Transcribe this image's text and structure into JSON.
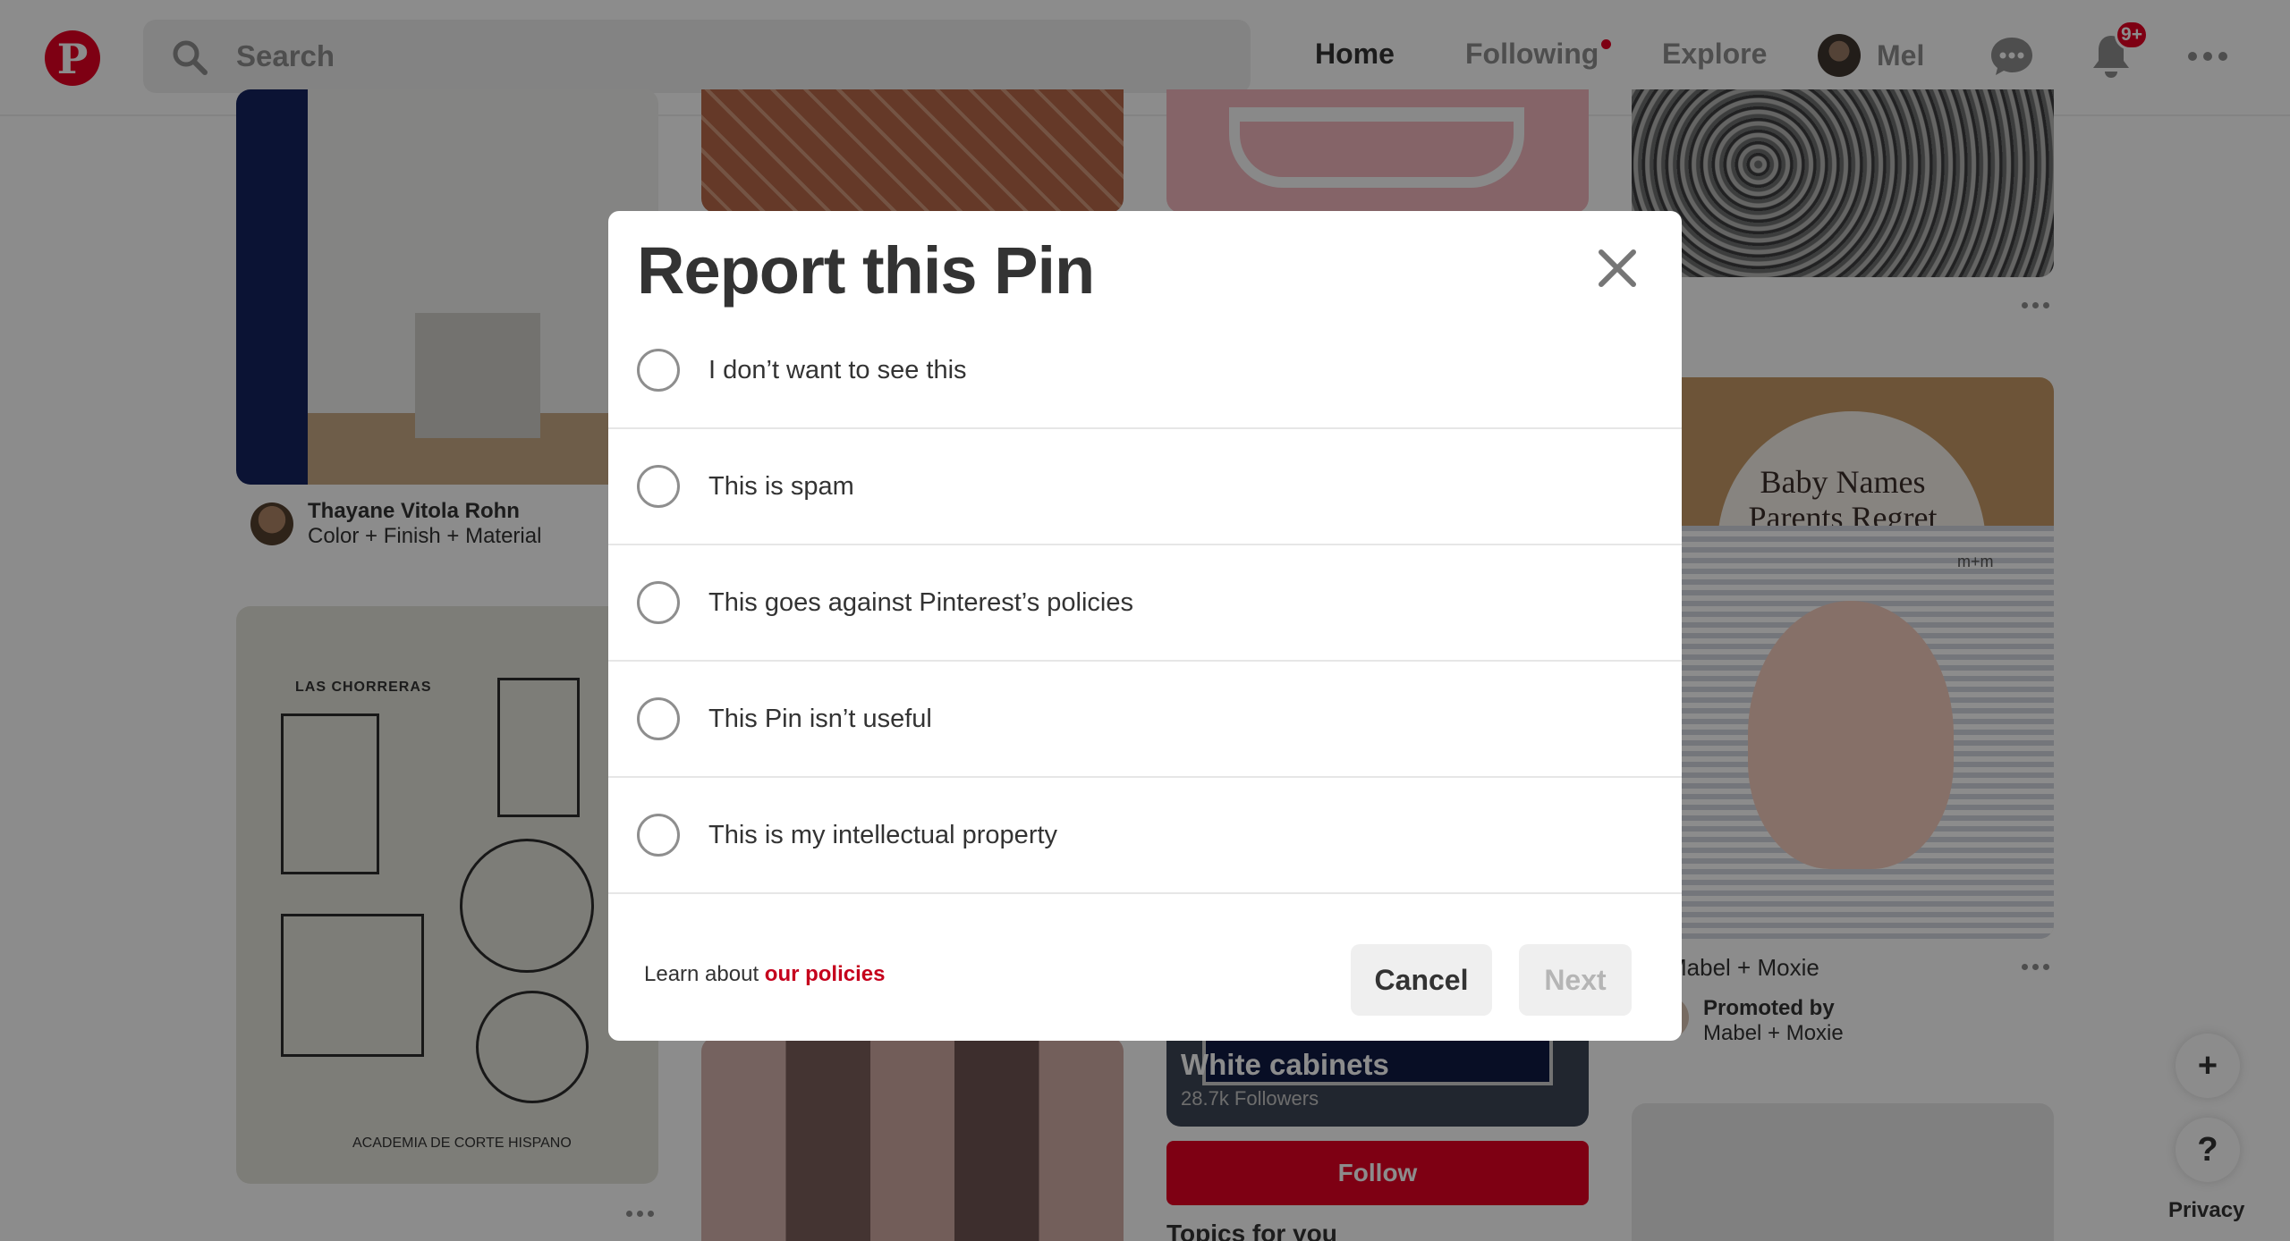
{
  "header": {
    "logo_letter": "P",
    "search_placeholder": "Search",
    "nav": {
      "home": "Home",
      "following": "Following",
      "explore": "Explore",
      "user": "Mel"
    },
    "notification_badge": "9+"
  },
  "feed": {
    "pin1": {
      "author": "Thayane Vitola Rohn",
      "board": "Color + Finish + Material"
    },
    "pattern_pin": {
      "title": "LAS CHORRERAS",
      "footer": "ACADEMIA DE CORTE HISPANO"
    },
    "board_card": {
      "title": "White cabinets",
      "followers": "28.7k Followers",
      "follow_label": "Follow"
    },
    "topics_heading": "Topics for you",
    "promo_pin": {
      "overlay_line1": "Baby Names",
      "overlay_line2": "Parents Regret",
      "brand_mark": "m+m",
      "title": "Mabel + Moxie",
      "promoted_label": "Promoted by",
      "promoter": "Mabel + Moxie"
    }
  },
  "floating": {
    "add_label": "+",
    "help_label": "?",
    "privacy": "Privacy"
  },
  "modal": {
    "title": "Report this Pin",
    "options": [
      "I don’t want to see this",
      "This is spam",
      "This goes against Pinterest’s policies",
      "This Pin isn’t useful",
      "This is my intellectual property"
    ],
    "learn_prefix": "Learn about ",
    "learn_link": "our policies",
    "cancel": "Cancel",
    "next": "Next"
  },
  "colors": {
    "brand": "#e60023",
    "link": "#c5001c"
  }
}
